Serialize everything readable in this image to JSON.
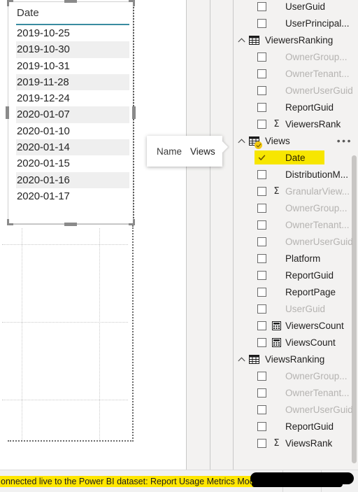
{
  "visual": {
    "column_header": "Date",
    "rows": [
      "2019-10-25",
      "2019-10-30",
      "2019-10-31",
      "2019-11-28",
      "2019-12-24",
      "2020-01-07",
      "2020-01-10",
      "2020-01-14",
      "2020-01-15",
      "2020-01-16",
      "2020-01-17"
    ],
    "header_underline_color": "#3a8ba0",
    "alt_row_color": "#efefef"
  },
  "tooltip": {
    "label": "Name",
    "value": "Views"
  },
  "fields_pane": {
    "ellipsis_label": "•••",
    "highlight_color": "#f7e600",
    "badge_color": "#f2c811",
    "groups": [
      {
        "name": "",
        "icon": "",
        "expanded": true,
        "highlighted": false,
        "has_menu": false,
        "fields": [
          {
            "label": "UserGuid",
            "checked": false,
            "dimmed": false,
            "icon": "none",
            "highlighted": false
          },
          {
            "label": "UserPrincipal...",
            "checked": false,
            "dimmed": false,
            "icon": "none",
            "highlighted": false
          }
        ]
      },
      {
        "name": "ViewersRanking",
        "icon": "table-icon",
        "expanded": true,
        "highlighted": false,
        "has_menu": false,
        "fields": [
          {
            "label": "OwnerGroup...",
            "checked": false,
            "dimmed": true,
            "icon": "none",
            "highlighted": false
          },
          {
            "label": "OwnerTenant...",
            "checked": false,
            "dimmed": true,
            "icon": "none",
            "highlighted": false
          },
          {
            "label": "OwnerUserGuid",
            "checked": false,
            "dimmed": true,
            "icon": "none",
            "highlighted": false
          },
          {
            "label": "ReportGuid",
            "checked": false,
            "dimmed": false,
            "icon": "none",
            "highlighted": false
          },
          {
            "label": "ViewersRank",
            "checked": false,
            "dimmed": false,
            "icon": "sigma",
            "highlighted": false
          }
        ]
      },
      {
        "name": "Views",
        "icon": "table-icon-checked",
        "expanded": true,
        "highlighted": true,
        "has_menu": true,
        "fields": [
          {
            "label": "Date",
            "checked": true,
            "dimmed": false,
            "icon": "none",
            "highlighted": true
          },
          {
            "label": "DistributionM...",
            "checked": false,
            "dimmed": false,
            "icon": "none",
            "highlighted": false
          },
          {
            "label": "GranularView...",
            "checked": false,
            "dimmed": true,
            "icon": "sigma",
            "highlighted": false
          },
          {
            "label": "OwnerGroup...",
            "checked": false,
            "dimmed": true,
            "icon": "none",
            "highlighted": false
          },
          {
            "label": "OwnerTenant...",
            "checked": false,
            "dimmed": true,
            "icon": "none",
            "highlighted": false
          },
          {
            "label": "OwnerUserGuid",
            "checked": false,
            "dimmed": true,
            "icon": "none",
            "highlighted": false
          },
          {
            "label": "Platform",
            "checked": false,
            "dimmed": false,
            "icon": "none",
            "highlighted": false
          },
          {
            "label": "ReportGuid",
            "checked": false,
            "dimmed": false,
            "icon": "none",
            "highlighted": false
          },
          {
            "label": "ReportPage",
            "checked": false,
            "dimmed": false,
            "icon": "none",
            "highlighted": false
          },
          {
            "label": "UserGuid",
            "checked": false,
            "dimmed": true,
            "icon": "none",
            "highlighted": false
          },
          {
            "label": "ViewersCount",
            "checked": false,
            "dimmed": false,
            "icon": "measure",
            "highlighted": false
          },
          {
            "label": "ViewsCount",
            "checked": false,
            "dimmed": false,
            "icon": "measure",
            "highlighted": false
          }
        ]
      },
      {
        "name": "ViewsRanking",
        "icon": "table-icon",
        "expanded": true,
        "highlighted": false,
        "has_menu": false,
        "fields": [
          {
            "label": "OwnerGroup...",
            "checked": false,
            "dimmed": true,
            "icon": "none",
            "highlighted": false
          },
          {
            "label": "OwnerTenant...",
            "checked": false,
            "dimmed": true,
            "icon": "none",
            "highlighted": false
          },
          {
            "label": "OwnerUserGuid",
            "checked": false,
            "dimmed": true,
            "icon": "none",
            "highlighted": false
          },
          {
            "label": "ReportGuid",
            "checked": false,
            "dimmed": false,
            "icon": "none",
            "highlighted": false
          },
          {
            "label": "ViewsRank",
            "checked": false,
            "dimmed": false,
            "icon": "sigma",
            "highlighted": false
          }
        ]
      }
    ]
  },
  "status_bar": {
    "text": "onnected live to the Power BI dataset: Report Usage Metrics Model in Do",
    "highlight_color": "#ffe600"
  }
}
